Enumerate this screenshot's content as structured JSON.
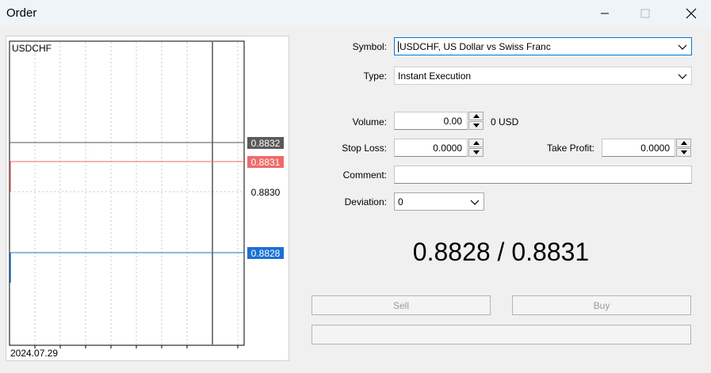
{
  "window": {
    "title": "Order"
  },
  "chart": {
    "symbol": "USDCHF",
    "date_label": "2024.07.29",
    "price_labels": {
      "level_top": "0.8832",
      "ask": "0.8831",
      "mid": "0.8830",
      "bid": "0.8828"
    },
    "colors": {
      "ask": "#ef6b6b",
      "bid": "#1a6fd6",
      "top_tag": "#5a5a5a"
    }
  },
  "form": {
    "symbol": {
      "label": "Symbol:",
      "value": "USDCHF, US Dollar vs Swiss Franc"
    },
    "type": {
      "label": "Type:",
      "value": "Instant Execution"
    },
    "volume": {
      "label": "Volume:",
      "value": "0.00",
      "unit": "0 USD"
    },
    "stop_loss": {
      "label": "Stop Loss:",
      "value": "0.0000"
    },
    "take_profit": {
      "label": "Take Profit:",
      "value": "0.0000"
    },
    "comment": {
      "label": "Comment:",
      "value": ""
    },
    "deviation": {
      "label": "Deviation:",
      "value": "0"
    }
  },
  "quote": {
    "text": "0.8828 / 0.8831"
  },
  "buttons": {
    "sell": "Sell",
    "buy": "Buy",
    "status": ""
  }
}
